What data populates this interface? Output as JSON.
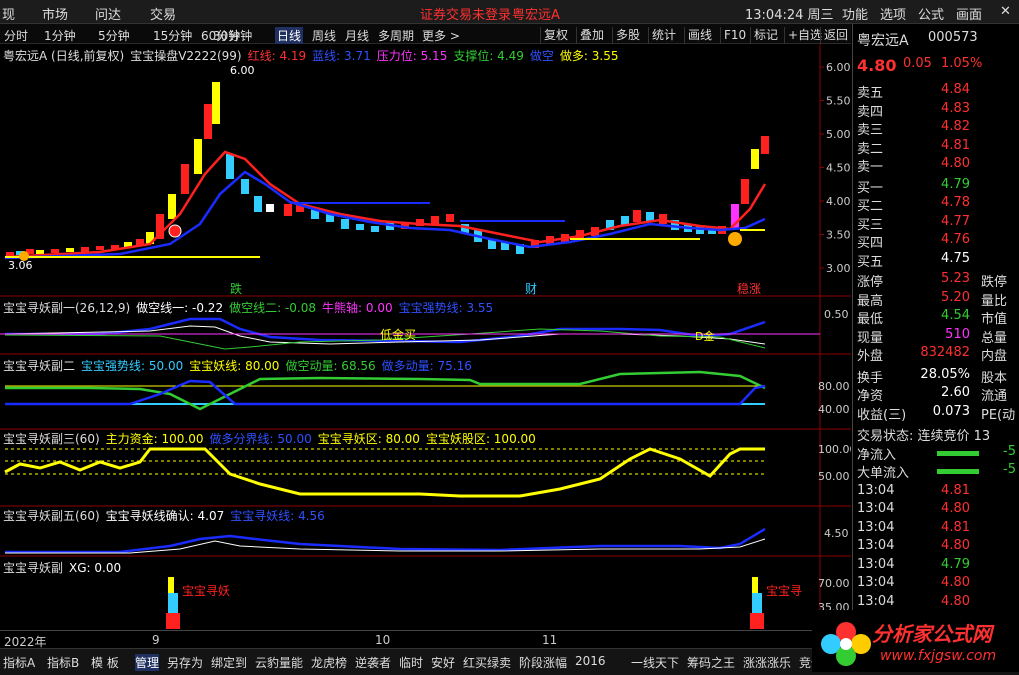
{
  "menubar": {
    "items": [
      "现",
      "市场",
      "问达",
      "交易"
    ],
    "notice": "证券交易未登录",
    "stock_title": "粤宏远A",
    "time": "13:04:24 周三",
    "right": [
      "功能",
      "选项",
      "公式",
      "画面"
    ],
    "close": "✕"
  },
  "toolbar": {
    "periods": [
      "分时",
      "1分钟",
      "5分钟",
      "15分钟",
      "30分钟",
      "60分钟",
      "日线",
      "周线",
      "月线",
      "多周期",
      "更多 >"
    ],
    "active": "日线",
    "right": [
      "复权",
      "叠加",
      "多股",
      "统计",
      "画线",
      "F10",
      "标记",
      "+自选",
      "返回"
    ]
  },
  "main": {
    "stock": "粤宏远A (日线,前复权)",
    "indicator": "宝宝操盘V2222(99)",
    "red_line": "红线: 4.19",
    "blue_line": "蓝线: 3.71",
    "pressure": "压力位: 5.15",
    "support": "支撑位: 4.49",
    "short": "做空",
    "long": "做多: 3.55",
    "y_ticks": [
      "6.00",
      "5.50",
      "5.00",
      "4.50",
      "4.00",
      "3.50",
      "3.00"
    ],
    "hi_label": "6.00",
    "lo_label": "3.06",
    "tags": [
      "跌",
      "财",
      "稳涨"
    ]
  },
  "panel1": {
    "title": "宝宝寻妖副一(26,12,9)",
    "short_line1": "做空线一: -0.22",
    "short_line2": "做空线二: -0.08",
    "bull_axis": "牛熊轴: 0.00",
    "trend": "宝宝强势线: 3.55",
    "low_buy": "低金买",
    "tick": "0.50",
    "tag": "D金"
  },
  "panel2": {
    "title": "宝宝寻妖副二",
    "strong": "宝宝强势线: 50.00",
    "yao": "宝宝妖线: 80.00",
    "short_power": "做空动量: 68.56",
    "long_power": "做多动量: 75.16",
    "ticks": [
      "80.00",
      "40.00"
    ]
  },
  "panel3": {
    "title": "宝宝寻妖副三(60)",
    "main_fund": "主力资金: 100.00",
    "boundary": "做多分界线: 50.00",
    "zone": "宝宝寻妖区: 80.00",
    "vol": "宝宝妖股区: 100.00",
    "ticks": [
      "100.00",
      "50.00"
    ]
  },
  "panel4": {
    "title": "宝宝寻妖副五(60)",
    "confirm": "宝宝寻妖线确认: 4.07",
    "line": "宝宝寻妖线: 4.56",
    "tick": "4.50"
  },
  "panel5": {
    "title": "宝宝寻妖副",
    "xg": "XG: 0.00",
    "signal": "宝宝寻妖",
    "signal2": "宝宝寻",
    "ticks": [
      "70.00",
      "35.00"
    ]
  },
  "dates": [
    "2022年",
    "9",
    "10",
    "11"
  ],
  "quote": {
    "name": "粤宏远A",
    "code": "000573",
    "price": "4.80",
    "change": "0.05",
    "pct": "1.05%",
    "asks": [
      {
        "l": "卖五",
        "v": "4.84"
      },
      {
        "l": "卖四",
        "v": "4.83"
      },
      {
        "l": "卖三",
        "v": "4.82"
      },
      {
        "l": "卖二",
        "v": "4.81"
      },
      {
        "l": "卖一",
        "v": "4.80"
      }
    ],
    "bids": [
      {
        "l": "买一",
        "v": "4.79"
      },
      {
        "l": "买二",
        "v": "4.78"
      },
      {
        "l": "买三",
        "v": "4.77"
      },
      {
        "l": "买四",
        "v": "4.76"
      },
      {
        "l": "买五",
        "v": "4.75"
      }
    ],
    "stats": [
      {
        "l": "涨停",
        "v": "5.23",
        "r": "跌停"
      },
      {
        "l": "最高",
        "v": "5.20",
        "r": "量比"
      },
      {
        "l": "最低",
        "v": "4.54",
        "r": "市值"
      },
      {
        "l": "现量",
        "v": "510",
        "r": "总量"
      },
      {
        "l": "外盘",
        "v": "832482",
        "r": "内盘"
      }
    ],
    "stats2": [
      {
        "l": "换手",
        "v": "28.05%",
        "r": "股本"
      },
      {
        "l": "净资",
        "v": "2.60",
        "r": "流通"
      },
      {
        "l": "收益(三)",
        "v": "0.073",
        "r": "PE(动"
      }
    ],
    "state": "交易状态: 连续竞价 13",
    "net_in": "净流入",
    "big_in": "大单流入",
    "flow_v": "-5",
    "ticks": [
      {
        "t": "13:04",
        "p": "4.81"
      },
      {
        "t": "13:04",
        "p": "4.80"
      },
      {
        "t": "13:04",
        "p": "4.81"
      },
      {
        "t": "13:04",
        "p": "4.80"
      },
      {
        "t": "13:04",
        "p": "4.79"
      },
      {
        "t": "13:04",
        "p": "4.80"
      },
      {
        "t": "13:04",
        "p": "4.80"
      },
      {
        "t": "13:04",
        "p": "4.80"
      }
    ]
  },
  "bottom": [
    "指标A",
    "指标B",
    "模 板",
    "管理",
    "另存为",
    "绑定到",
    "云豹量能",
    "龙虎榜",
    "逆袭者",
    "临时",
    "安好",
    "红买绿卖",
    "阶段涨幅",
    "2016",
    "一线天下",
    "筹码之王",
    "涨涨涨乐",
    "竞价"
  ],
  "logo": {
    "name": "分析家公式网",
    "url": "www.fxjgsw.com"
  },
  "colors": {
    "red": "#ff2020",
    "blue": "#1a2cff",
    "yellow": "#ffff00",
    "green": "#33cc33",
    "magenta": "#ff33ff",
    "cyan": "#33ccff"
  }
}
